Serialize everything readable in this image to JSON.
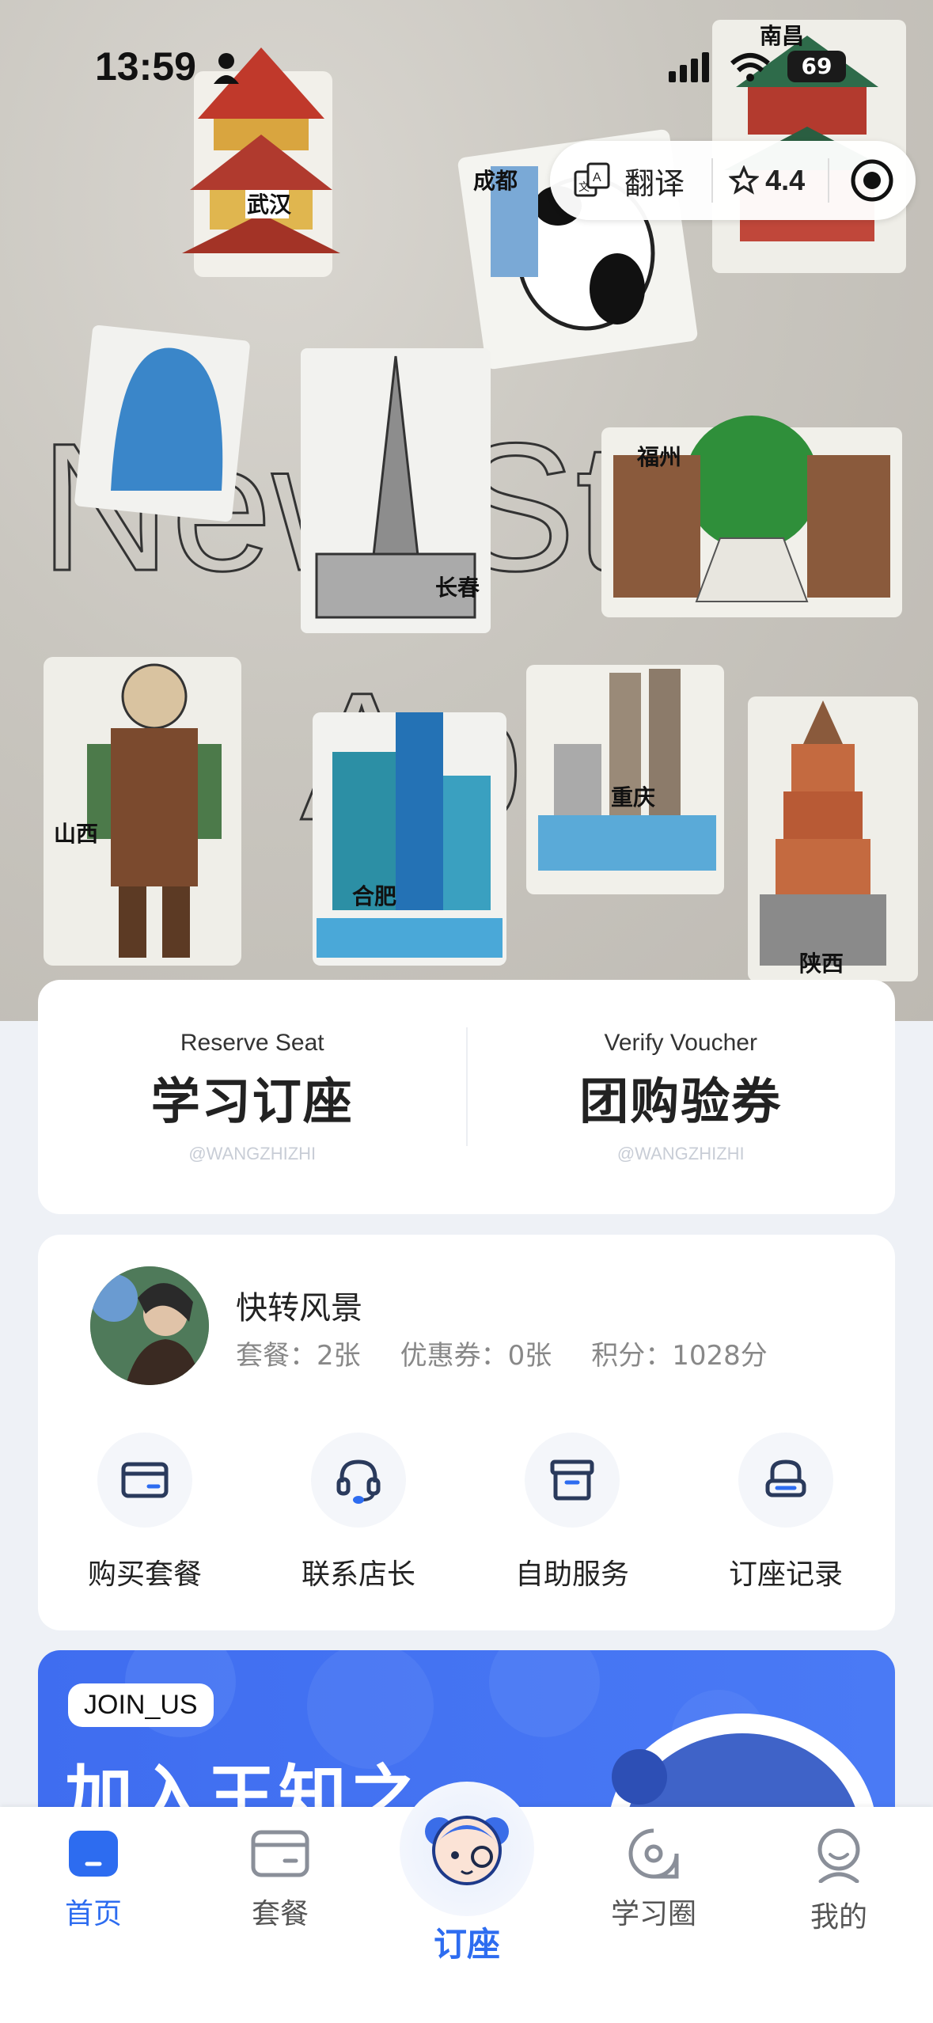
{
  "status_bar": {
    "time": "13:59",
    "battery": "69"
  },
  "hero": {
    "bg_words": [
      "New Style",
      "April"
    ],
    "city_labels": [
      "武汉",
      "成都",
      "南昌",
      "长春",
      "福州",
      "山西",
      "合肥",
      "重庆",
      "陕西"
    ]
  },
  "capsule": {
    "translate_label": "翻译",
    "rating": "4.4"
  },
  "reserve": {
    "left": {
      "en": "Reserve Seat",
      "cn": "学习订座",
      "watermark": "@WANGZHIZHI"
    },
    "right": {
      "en": "Verify Voucher",
      "cn": "团购验券",
      "watermark": "@WANGZHIZHI"
    }
  },
  "user": {
    "name": "快转风景",
    "stats": {
      "package": "套餐：2张",
      "coupon": "优惠券：0张",
      "points": "积分：1028分"
    },
    "actions": [
      {
        "label": "购买套餐",
        "icon": "card-icon"
      },
      {
        "label": "联系店长",
        "icon": "headset-icon"
      },
      {
        "label": "自助服务",
        "icon": "archive-box-icon"
      },
      {
        "label": "订座记录",
        "icon": "seat-icon"
      }
    ]
  },
  "join": {
    "tag": "JOIN_US",
    "title": "加入王知之"
  },
  "tabbar": {
    "items": [
      {
        "label": "首页",
        "icon": "home-icon",
        "active": true
      },
      {
        "label": "套餐",
        "icon": "package-icon",
        "active": false
      },
      {
        "label": "订座",
        "icon": "mascot-icon",
        "active": false
      },
      {
        "label": "学习圈",
        "icon": "chat-circle-icon",
        "active": false
      },
      {
        "label": "我的",
        "icon": "profile-icon",
        "active": false
      }
    ]
  },
  "colors": {
    "accent": "#2d6cf0",
    "banner": "#4a7af5"
  }
}
